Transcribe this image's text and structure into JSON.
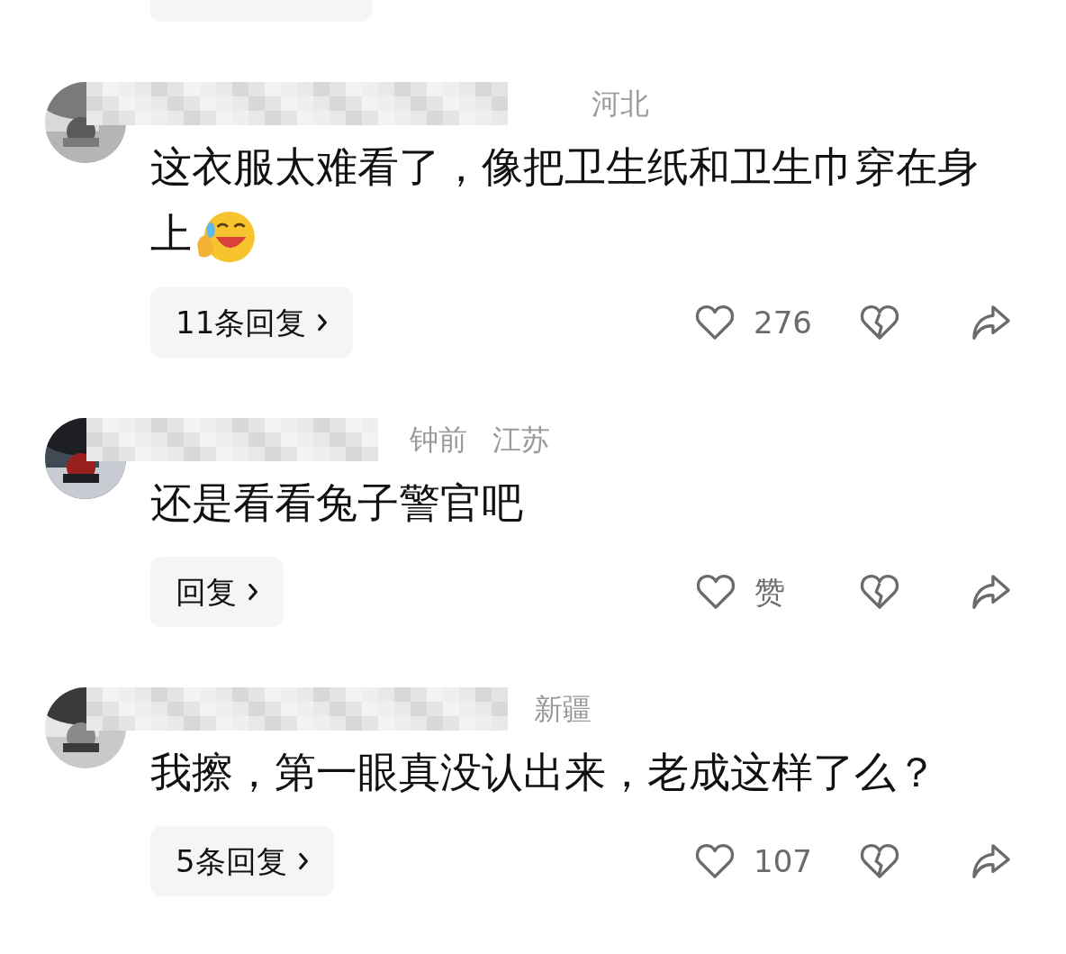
{
  "comments": [
    {
      "location": "河北",
      "text": "这衣服太难看了，像把卫生纸和卫生巾穿在身上",
      "emoji": true,
      "reply": "11条回复",
      "likes": "276"
    },
    {
      "time": "钟前",
      "location": "江苏",
      "text": "还是看看兔子警官吧",
      "emoji": false,
      "reply": "回复",
      "likes": "赞"
    },
    {
      "location": "新疆",
      "text": "我擦，第一眼真没认出来，老成这样了么？",
      "emoji": false,
      "reply": "5条回复",
      "likes": "107"
    }
  ]
}
